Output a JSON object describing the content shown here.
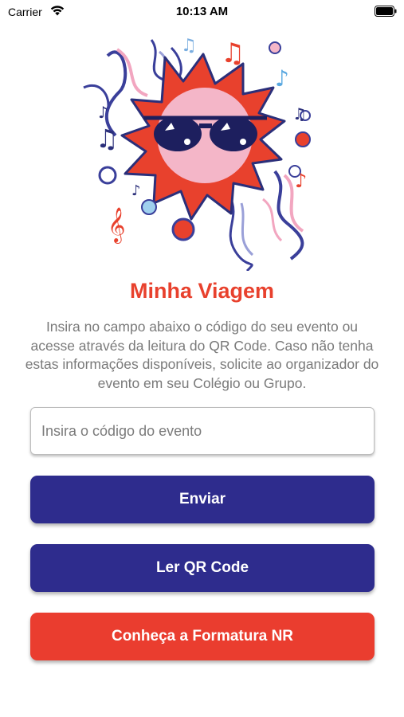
{
  "status_bar": {
    "carrier": "Carrier",
    "time": "10:13 AM"
  },
  "hero": {
    "illustration": "sun-with-sunglasses-confetti-music-notes"
  },
  "main": {
    "title": "Minha Viagem",
    "description": "Insira no campo abaixo o código do seu evento ou acesse através da leitura do QR Code. Caso não tenha estas informações disponíveis, solicite ao organizador do evento em seu Colégio ou Grupo.",
    "event_code_placeholder": "Insira o código do evento",
    "event_code_value": "",
    "send_label": "Enviar",
    "qr_label": "Ler QR Code",
    "formatura_label": "Conheça a Formatura NR"
  },
  "colors": {
    "brand_red": "#E8412D",
    "brand_blue": "#2E2C8D",
    "text_gray": "#7a7a7a"
  }
}
